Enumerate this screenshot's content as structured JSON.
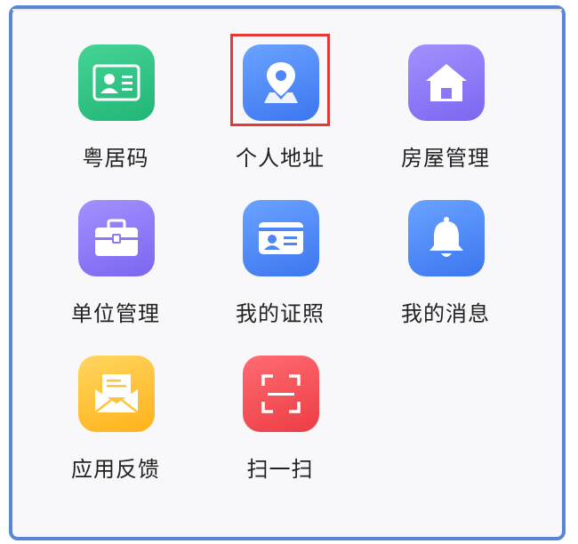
{
  "colors": {
    "green": "#2fc383",
    "blue": "#4f86f7",
    "purple": "#8a78f6",
    "yellow": "#ffc438",
    "red": "#f14f55",
    "highlight": "#e53935",
    "frame": "#5a86d6"
  },
  "grid": [
    {
      "id": "yue-ju-ma",
      "label": "粤居码",
      "icon": "id-card-icon",
      "color": "green"
    },
    {
      "id": "personal-address",
      "label": "个人地址",
      "icon": "location-pin-icon",
      "color": "blue",
      "highlighted": true
    },
    {
      "id": "house-management",
      "label": "房屋管理",
      "icon": "house-icon",
      "color": "purple"
    },
    {
      "id": "unit-management",
      "label": "单位管理",
      "icon": "briefcase-icon",
      "color": "purple"
    },
    {
      "id": "my-certificates",
      "label": "我的证照",
      "icon": "id-card-icon",
      "color": "blue"
    },
    {
      "id": "my-messages",
      "label": "我的消息",
      "icon": "bell-icon",
      "color": "blue"
    },
    {
      "id": "app-feedback",
      "label": "应用反馈",
      "icon": "mail-icon",
      "color": "yellow"
    },
    {
      "id": "scan",
      "label": "扫一扫",
      "icon": "scan-icon",
      "color": "red"
    }
  ]
}
